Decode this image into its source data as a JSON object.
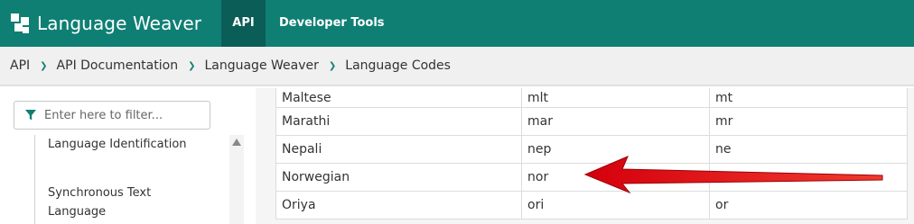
{
  "header": {
    "brand": "Language Weaver",
    "nav": [
      {
        "label": "API",
        "active": true
      },
      {
        "label": "Developer Tools",
        "active": false
      }
    ],
    "colors": {
      "bar": "#0f7f74",
      "active_tab": "#0b5d57"
    }
  },
  "breadcrumb": [
    "API",
    "API Documentation",
    "Language Weaver",
    "Language Codes"
  ],
  "sidebar": {
    "filter_placeholder": "Enter here to filter...",
    "items": [
      {
        "label": "Language Identification"
      },
      {
        "label": "Synchronous Text Language"
      }
    ]
  },
  "table": {
    "rows": [
      {
        "name": "Maltese",
        "code3": "mlt",
        "code2": "mt"
      },
      {
        "name": "Marathi",
        "code3": "mar",
        "code2": "mr"
      },
      {
        "name": "Nepali",
        "code3": "nep",
        "code2": "ne"
      },
      {
        "name": "Norwegian",
        "code3": "nor",
        "code2": ""
      },
      {
        "name": "Oriya",
        "code3": "ori",
        "code2": "or"
      }
    ]
  },
  "annotation": {
    "type": "red-arrow-icon",
    "target": "Norwegian",
    "color": "#e0101a"
  }
}
